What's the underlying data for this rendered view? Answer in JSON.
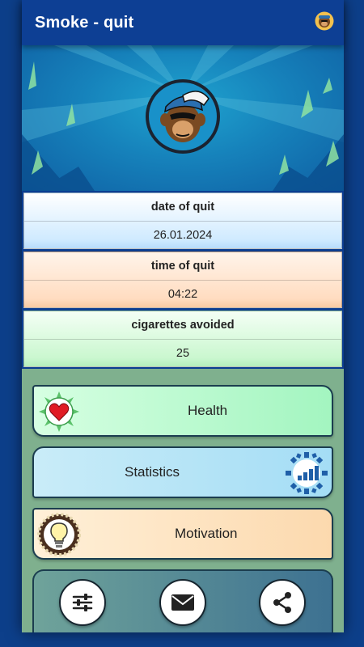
{
  "app": {
    "title": "Smoke - quit"
  },
  "info": {
    "date_label": "date of quit",
    "date_value": "26.01.2024",
    "time_label": "time of quit",
    "time_value": "04:22",
    "cigs_label": "cigarettes avoided",
    "cigs_value": "25"
  },
  "menu": {
    "health_label": "Health",
    "statistics_label": "Statistics",
    "motivation_label": "Motivation"
  },
  "icons": {
    "app_logo": "monkey-logo-icon",
    "health": "heart-icon",
    "statistics": "bar-chart-icon",
    "motivation": "light-bulb-icon",
    "settings": "sliders-icon",
    "mail": "envelope-icon",
    "share": "share-icon"
  },
  "colors": {
    "primary": "#0d3f94",
    "menu_background": "#7fb08e",
    "date_card": "#cfeaff",
    "time_card": "#ffdcc0",
    "cigs_card": "#caf7cf"
  }
}
